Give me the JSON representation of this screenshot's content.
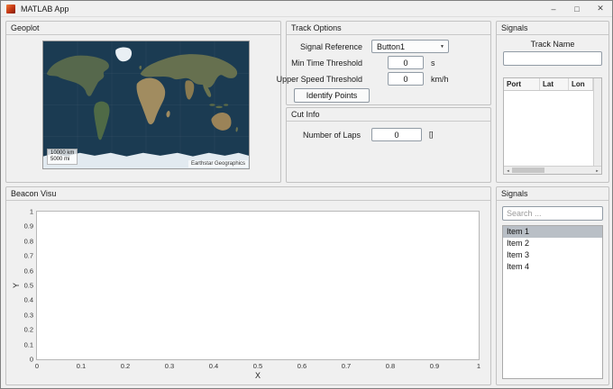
{
  "window": {
    "title": "MATLAB App",
    "minimize": "–",
    "maximize": "□",
    "close": "✕"
  },
  "icons": {
    "dropdown_arrow": "▼",
    "scroll_left": "◄",
    "scroll_right": "►"
  },
  "colors": {
    "ocean": "#1b3b52",
    "land_green": "#56684c",
    "land_tan": "#a18c60",
    "ice": "#e6edf3",
    "list_selection": "#b9bfc6"
  },
  "geoplot": {
    "title": "Geoplot",
    "scale_km": "10000 km",
    "scale_mi": "5000 mi",
    "attribution": "Earthstar Geographics"
  },
  "track_options": {
    "title": "Track Options",
    "signal_reference_label": "Signal Reference",
    "signal_reference_value": "Button1",
    "min_time_label": "Min Time Threshold",
    "min_time_value": "0",
    "min_time_unit": "s",
    "upper_speed_label": "Upper Speed Threshold",
    "upper_speed_value": "0",
    "upper_speed_unit": "km/h",
    "identify_button": "Identify Points"
  },
  "cut_info": {
    "title": "Cut Info",
    "laps_label": "Number of Laps",
    "laps_value": "0",
    "laps_unit": "[]"
  },
  "signals_top": {
    "title": "Signals",
    "track_name_label": "Track Name",
    "track_name_value": "",
    "table_headers": [
      "Port",
      "Lat",
      "Lon"
    ]
  },
  "beacon": {
    "title": "Beacon Visu",
    "xlabel": "X",
    "ylabel": "Y",
    "x_ticks": [
      "0",
      "0.1",
      "0.2",
      "0.3",
      "0.4",
      "0.5",
      "0.6",
      "0.7",
      "0.8",
      "0.9",
      "1"
    ],
    "y_ticks": [
      "0",
      "0.1",
      "0.2",
      "0.3",
      "0.4",
      "0.5",
      "0.6",
      "0.7",
      "0.8",
      "0.9",
      "1"
    ]
  },
  "signals_bottom": {
    "title": "Signals",
    "search_placeholder": "Search ...",
    "items": [
      {
        "label": "Item 1",
        "selected": true
      },
      {
        "label": "Item 2",
        "selected": false
      },
      {
        "label": "Item 3",
        "selected": false
      },
      {
        "label": "Item 4",
        "selected": false
      }
    ]
  }
}
